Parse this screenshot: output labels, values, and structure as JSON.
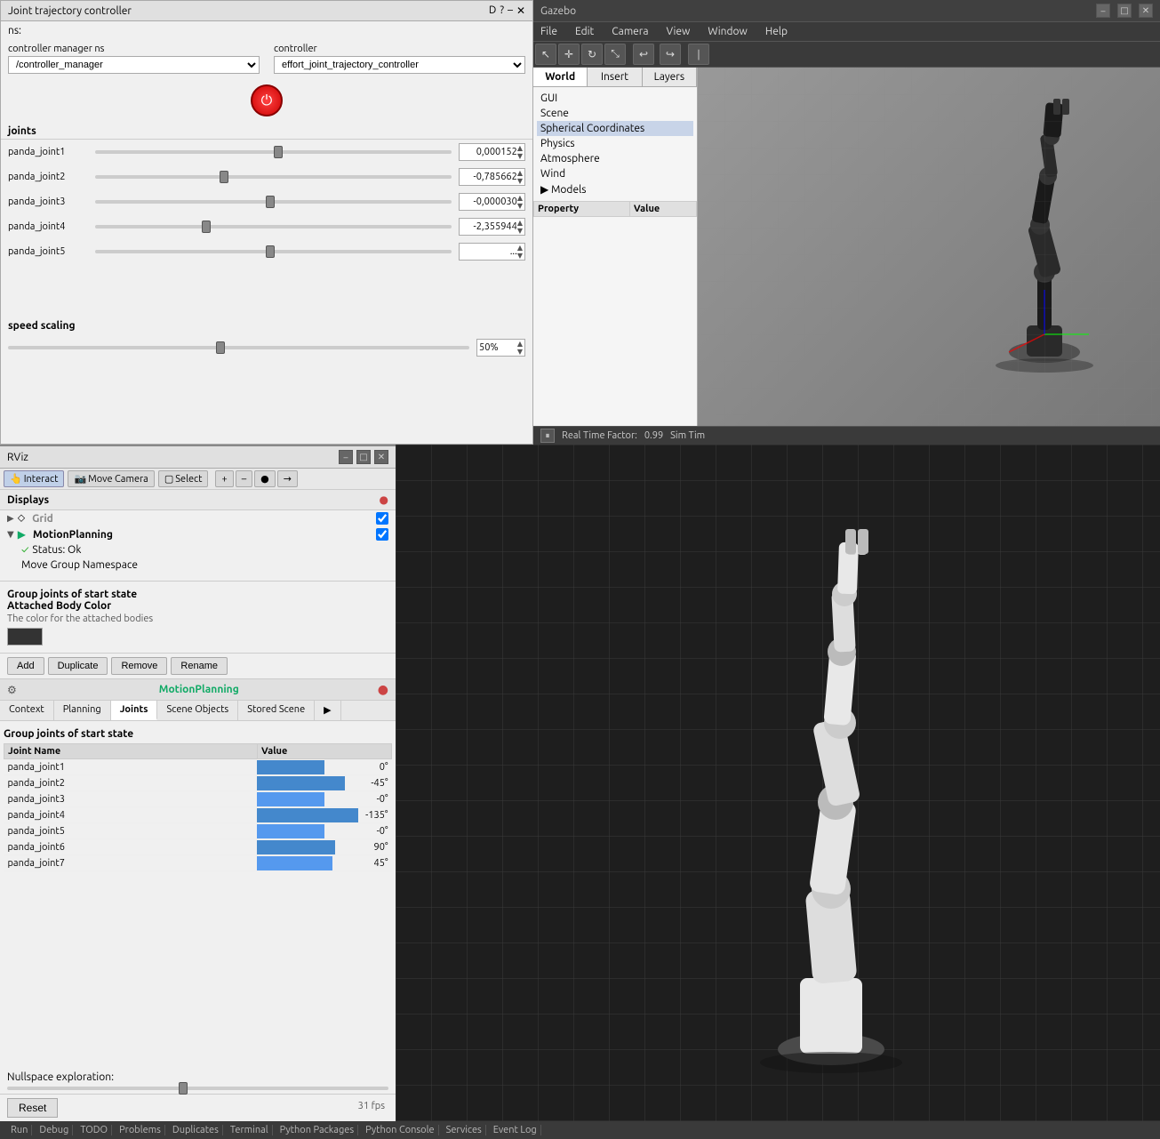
{
  "joint_controller": {
    "title": "Joint trajectory controller",
    "ns_label": "ns:",
    "controller_manager_label": "controller manager ns",
    "controller_label": "controller",
    "controller_manager_value": "/controller_manager",
    "controller_value": "effort_joint_trajectory_controller",
    "joints_label": "joints",
    "speed_scaling_label": "speed scaling",
    "speed_value": "50%",
    "joints": [
      {
        "name": "panda_joint1",
        "value": "0,000152",
        "thumb_pos": "50%"
      },
      {
        "name": "panda_joint2",
        "value": "-0,785662",
        "thumb_pos": "35%"
      },
      {
        "name": "panda_joint3",
        "value": "-0,000030",
        "thumb_pos": "48%"
      },
      {
        "name": "panda_joint4",
        "value": "-2,355944",
        "thumb_pos": "30%"
      },
      {
        "name": "panda_joint5",
        "value": "...",
        "thumb_pos": "48%"
      }
    ]
  },
  "gazebo": {
    "title": "Gazebo",
    "menu": [
      "File",
      "Edit",
      "Camera",
      "View",
      "Window",
      "Help"
    ],
    "tabs": [
      "World",
      "Insert",
      "Layers"
    ],
    "active_tab": "World",
    "tree_items": [
      "GUI",
      "Scene",
      "Spherical Coordinates",
      "Physics",
      "Atmosphere",
      "Wind",
      "Models"
    ],
    "prop_headers": [
      "Property",
      "Value"
    ],
    "status": {
      "real_time_label": "Real Time Factor:",
      "real_time_value": "0.99",
      "sim_time_label": "Sim Tim"
    }
  },
  "rviz": {
    "title": "RViz",
    "tools": [
      "Interact",
      "Move Camera",
      "Select"
    ],
    "active_tool": "Interact",
    "displays_label": "Displays",
    "display_items": [
      {
        "name": "Grid",
        "type": "grid",
        "checked": true,
        "expanded": false
      },
      {
        "name": "MotionPlanning",
        "type": "motion",
        "checked": true,
        "expanded": true
      }
    ],
    "display_sub_items": [
      {
        "name": "Status: Ok"
      },
      {
        "name": "Move Group Namespace"
      }
    ],
    "attached_body": {
      "title": "Attached Body Color",
      "description": "The color for the attached bodies"
    },
    "buttons": [
      "Add",
      "Duplicate",
      "Remove",
      "Rename"
    ],
    "motion_planning": {
      "title": "MotionPlanning",
      "tabs": [
        "Context",
        "Planning",
        "Joints",
        "Scene Objects",
        "Stored Scene"
      ],
      "active_tab": "Joints",
      "group_label": "Group joints of start state",
      "table_headers": [
        "Joint Name",
        "Value"
      ],
      "joints": [
        {
          "name": "panda_joint1",
          "value": "0°",
          "bar_pct": 50,
          "highlight": false
        },
        {
          "name": "panda_joint2",
          "value": "-45°",
          "bar_pct": 65,
          "highlight": false
        },
        {
          "name": "panda_joint3",
          "value": "-0°",
          "bar_pct": 50,
          "highlight": true
        },
        {
          "name": "panda_joint4",
          "value": "-135°",
          "bar_pct": 75,
          "highlight": false
        },
        {
          "name": "panda_joint5",
          "value": "-0°",
          "bar_pct": 50,
          "highlight": true
        },
        {
          "name": "panda_joint6",
          "value": "90°",
          "bar_pct": 58,
          "highlight": false
        },
        {
          "name": "panda_joint7",
          "value": "45°",
          "bar_pct": 56,
          "highlight": true
        }
      ],
      "nullspace_label": "Nullspace exploration:"
    },
    "fps": "31 fps",
    "reset_btn": "Reset"
  },
  "bottom_status": [
    "Run",
    "Debug",
    "TODO",
    "Problems",
    "Duplicates",
    "Terminal",
    "Python Packages",
    "Python Console",
    "Services",
    "Event Log"
  ]
}
